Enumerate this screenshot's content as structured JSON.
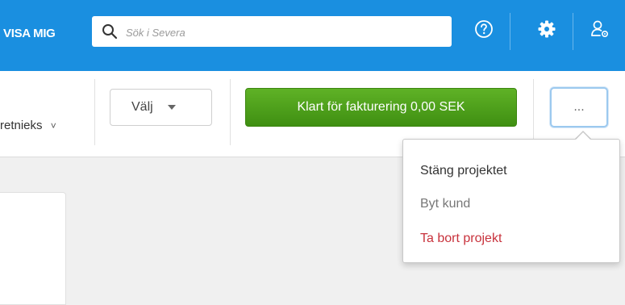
{
  "header": {
    "user_menu_label": "VISA MIG",
    "search": {
      "placeholder": "Sök i Severa",
      "value": ""
    },
    "icons": [
      "search-icon",
      "help-icon",
      "gear-icon",
      "user-settings-icon"
    ]
  },
  "toolbar": {
    "person_select_text": "retnieks",
    "valj_label": "Välj",
    "ready_for_invoicing_label": "Klart för fakturering 0,00 SEK",
    "more_label": "..."
  },
  "menu": {
    "items": [
      {
        "label": "Stäng projektet",
        "color": "#333333"
      },
      {
        "label": "Byt kund",
        "color": "#777777"
      },
      {
        "label": "Ta bort projekt",
        "color": "#c8323c"
      }
    ]
  },
  "colors": {
    "brand_blue": "#1a8fe0",
    "success_green": "#4aa01a",
    "danger_red": "#c8323c"
  }
}
